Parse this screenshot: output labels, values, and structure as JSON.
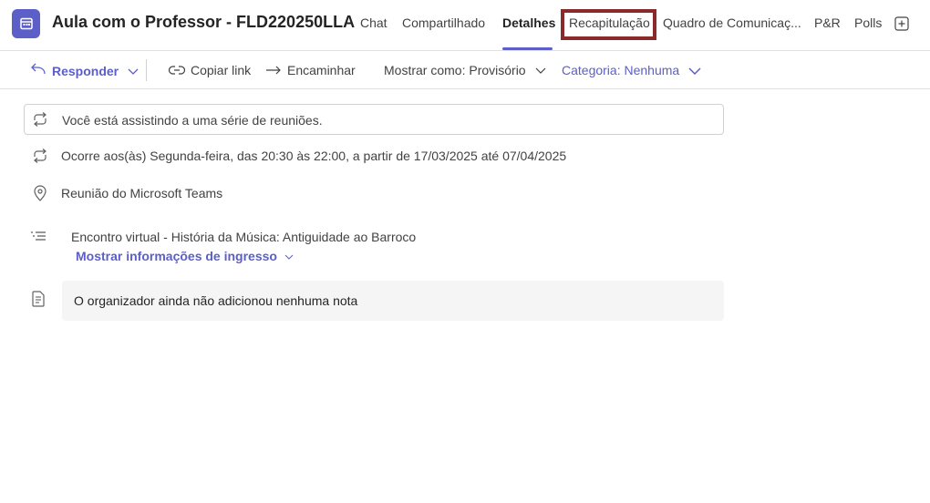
{
  "header": {
    "title": "Aula com o Professor - FLD220250LLA",
    "tabs": [
      {
        "label": "Chat"
      },
      {
        "label": "Compartilhado"
      },
      {
        "label": "Detalhes"
      },
      {
        "label": "Recapitulação"
      },
      {
        "label": "Quadro de Comunicaç..."
      },
      {
        "label": "P&R"
      },
      {
        "label": "Polls"
      }
    ],
    "active_tab": "Detalhes",
    "highlighted_tab": "Recapitulação"
  },
  "toolbar": {
    "reply_label": "Responder",
    "copy_link_label": "Copiar link",
    "forward_label": "Encaminhar",
    "show_as_label": "Mostrar como: Provisório",
    "category_label": "Categoria: Nenhuma"
  },
  "details": {
    "series_notice": "Você está assistindo a uma série de reuniões.",
    "recurrence": "Ocorre aos(às) Segunda-feira, das 20:30 às 22:00, a partir de 17/03/2025 até 07/04/2025",
    "location": "Reunião do Microsoft Teams",
    "description": "Encontro virtual - História da Música: Antiguidade ao Barroco",
    "join_info_link": "Mostrar informações de ingresso",
    "notes": "O organizador ainda não adicionou nenhuma nota"
  },
  "colors": {
    "accent": "#5b5fc7",
    "highlight_border": "#8b2a2a"
  },
  "icons": [
    "calendar-icon",
    "add-tab-icon",
    "reply-icon",
    "chevron-down-icon",
    "link-icon",
    "forward-icon",
    "repeat-icon",
    "location-pin-icon",
    "list-icon",
    "notes-icon"
  ]
}
